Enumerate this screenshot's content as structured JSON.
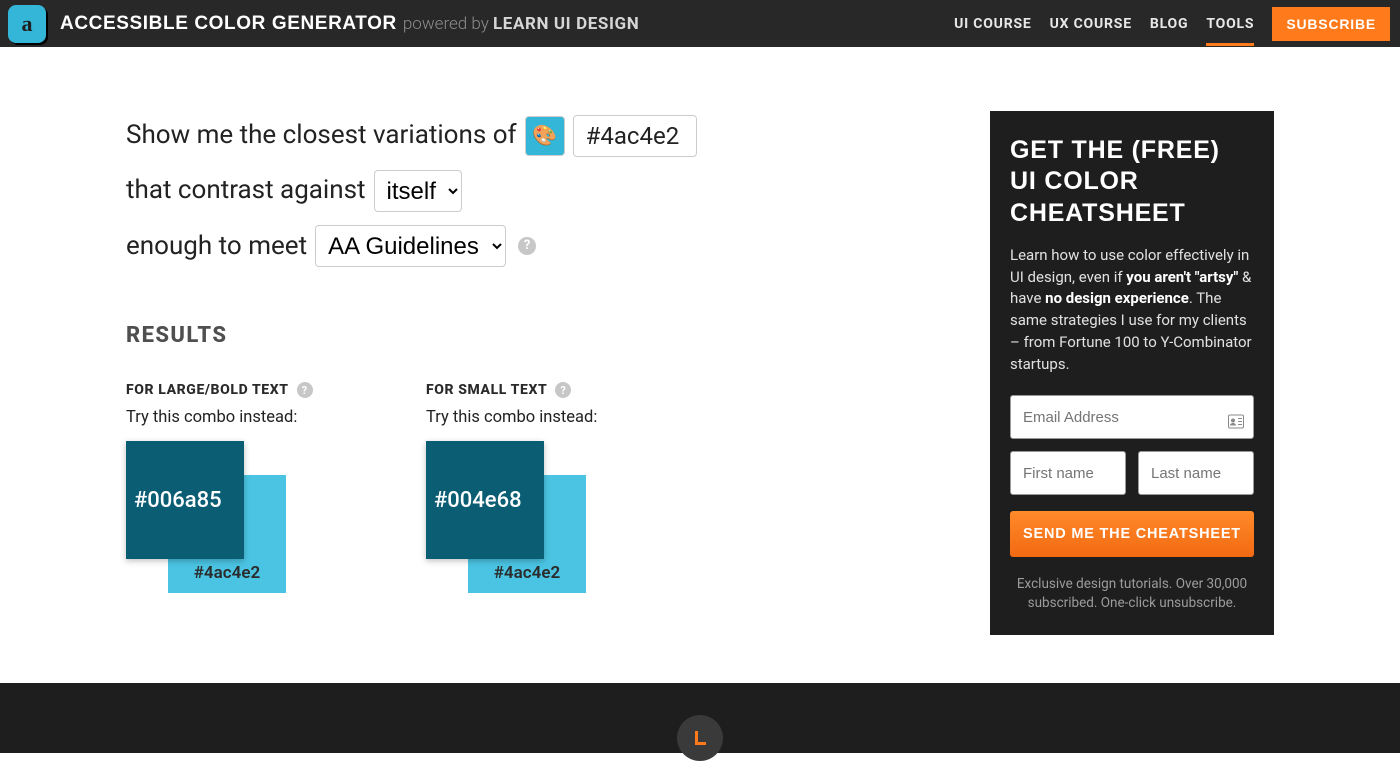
{
  "header": {
    "logo_letter": "a",
    "title": "ACCESSIBLE COLOR GENERATOR",
    "powered_prefix": "powered by",
    "powered_brand": "LEARN UI DESIGN",
    "nav": {
      "ui_course": "UI COURSE",
      "ux_course": "UX COURSE",
      "blog": "BLOG",
      "tools": "TOOLS",
      "subscribe": "SUBSCRIBE"
    }
  },
  "form": {
    "line1_prefix": "Show me the closest variations of",
    "palette_emoji": "🎨",
    "color_value": "#4ac4e2",
    "line2_prefix": "that contrast against",
    "contrast_target": "itself",
    "line3_prefix": "enough to meet",
    "guideline": "AA Guidelines"
  },
  "results": {
    "heading": "RESULTS",
    "large": {
      "label": "FOR LARGE/BOLD TEXT",
      "try": "Try this combo instead:",
      "front_hex": "#006a85",
      "back_hex": "#4ac4e2",
      "front_color": "#0b5d74",
      "back_color": "#4ac4e2"
    },
    "small": {
      "label": "FOR SMALL TEXT",
      "try": "Try this combo instead:",
      "front_hex": "#004e68",
      "back_hex": "#4ac4e2",
      "front_color": "#0b5d74",
      "back_color": "#4ac4e2"
    }
  },
  "promo": {
    "title": "GET THE (FREE) UI COLOR CHEATSHEET",
    "body_pre": "Learn how to use color effectively in UI design, even if ",
    "body_bold1": "you aren't \"artsy\"",
    "body_mid": " & have ",
    "body_bold2": "no design experience",
    "body_post": ". The same strategies I use for my clients – from Fortune 100 to Y-Combinator startups.",
    "email_placeholder": "Email Address",
    "first_placeholder": "First name",
    "last_placeholder": "Last name",
    "cta": "SEND ME THE CHEATSHEET",
    "footnote": "Exclusive design tutorials. Over 30,000 subscribed. One-click unsubscribe."
  }
}
